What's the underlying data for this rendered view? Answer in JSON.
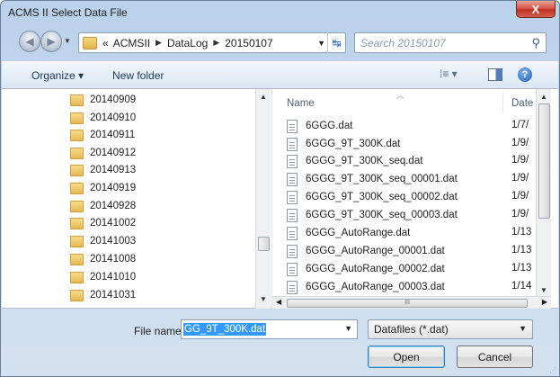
{
  "window": {
    "title": "ACMS II Select Data File",
    "close_glyph": "X"
  },
  "address": {
    "crumbs": [
      "ACMSII",
      "DataLog",
      "20150107"
    ],
    "overflow_glyph": "«",
    "search_placeholder": "Search 20150107"
  },
  "toolbar": {
    "organize": "Organize ▾",
    "new_folder": "New folder",
    "views_glyph": "⁞≡ ▾",
    "help_glyph": "?"
  },
  "nav_pane": {
    "folders": [
      "20140909",
      "20140910",
      "20140911",
      "20140912",
      "20140913",
      "20140919",
      "20140928",
      "20141002",
      "20141003",
      "20141008",
      "20141010",
      "20141031"
    ]
  },
  "file_list": {
    "columns": {
      "name": "Name",
      "date": "Date"
    },
    "files": [
      {
        "name": "6GGG.dat",
        "date": "1/7/"
      },
      {
        "name": "6GGG_9T_300K.dat",
        "date": "1/9/"
      },
      {
        "name": "6GGG_9T_300K_seq.dat",
        "date": "1/9/"
      },
      {
        "name": "6GGG_9T_300K_seq_00001.dat",
        "date": "1/9/"
      },
      {
        "name": "6GGG_9T_300K_seq_00002.dat",
        "date": "1/9/"
      },
      {
        "name": "6GGG_9T_300K_seq_00003.dat",
        "date": "1/9/"
      },
      {
        "name": "6GGG_AutoRange.dat",
        "date": "1/13"
      },
      {
        "name": "6GGG_AutoRange_00001.dat",
        "date": "1/13"
      },
      {
        "name": "6GGG_AutoRange_00002.dat",
        "date": "1/13"
      },
      {
        "name": "6GGG_AutoRange_00003.dat",
        "date": "1/14"
      }
    ],
    "hscroll_grip": "III"
  },
  "bottom": {
    "file_name_label": "File name:",
    "file_name_value": "GG_9T_300K.dat",
    "file_type_value": "Datafiles (*.dat)",
    "open_label": "Open",
    "cancel_label": "Cancel"
  },
  "colors": {
    "selection": "#3399ff",
    "window_frame": "#b9d1ea",
    "close_button": "#c12f23"
  }
}
